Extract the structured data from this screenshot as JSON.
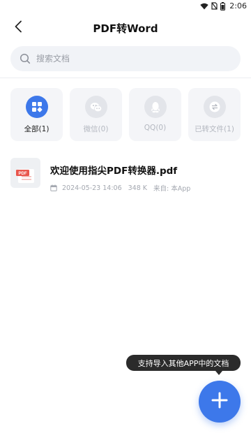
{
  "status_bar": {
    "time": "2:06",
    "icons": [
      "wifi-icon",
      "no-sim-icon",
      "battery-icon"
    ]
  },
  "header": {
    "title": "PDF转Word",
    "back_icon": "chevron-left-icon"
  },
  "search": {
    "placeholder": "搜索文档",
    "value": ""
  },
  "categories": [
    {
      "label": "全部(1)",
      "icon": "grid-icon",
      "active": true
    },
    {
      "label": "微信(0)",
      "icon": "wechat-icon",
      "active": false
    },
    {
      "label": "QQ(0)",
      "icon": "qq-icon",
      "active": false
    },
    {
      "label": "已转文件(1)",
      "icon": "convert-icon",
      "active": false
    }
  ],
  "files": [
    {
      "name": "欢迎使用指尖PDF转换器.pdf",
      "thumb_badge": "PDF",
      "date": "2024-05-23 14:06",
      "size": "348 K",
      "source": "来自: 本App"
    }
  ],
  "tooltip": {
    "text": "支持导入其他APP中的文档"
  },
  "fab": {
    "icon": "plus-icon"
  },
  "colors": {
    "accent": "#3d78ea",
    "pdf_badge": "#e9564d",
    "tooltip_bg": "#2b2b2b"
  }
}
